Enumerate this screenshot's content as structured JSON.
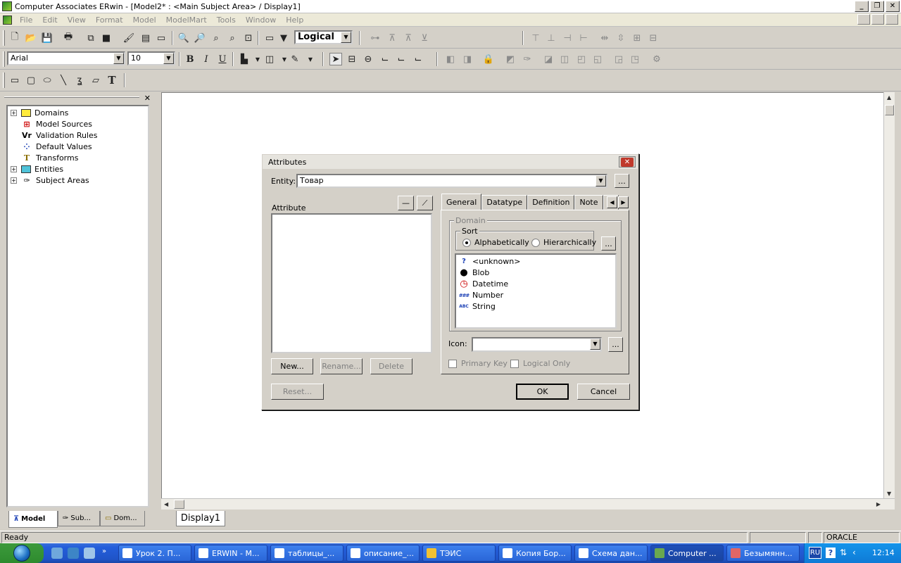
{
  "window": {
    "title": "Computer Associates ERwin - [Model2* : <Main Subject Area> / Display1]"
  },
  "menu": [
    "File",
    "Edit",
    "View",
    "Format",
    "Model",
    "ModelMart",
    "Tools",
    "Window",
    "Help"
  ],
  "toolbar": {
    "view_mode": "Logical",
    "font_name": "Arial",
    "font_size": "10",
    "bold": "B",
    "italic": "I",
    "underline": "U",
    "text_tool": "T"
  },
  "tree": {
    "items": [
      {
        "label": "Domains",
        "expandable": true,
        "icon": "domains-icon"
      },
      {
        "label": "Model Sources",
        "expandable": false,
        "icon": "model-sources-icon"
      },
      {
        "label": "Validation Rules",
        "expandable": false,
        "icon": "validation-rules-icon"
      },
      {
        "label": "Default Values",
        "expandable": false,
        "icon": "default-values-icon"
      },
      {
        "label": "Transforms",
        "expandable": false,
        "icon": "transforms-icon"
      },
      {
        "label": "Entities",
        "expandable": true,
        "icon": "entities-icon"
      },
      {
        "label": "Subject Areas",
        "expandable": true,
        "icon": "subject-areas-icon"
      }
    ],
    "plus_sign": "+"
  },
  "left_tabs": [
    "Model",
    "Sub...",
    "Dom..."
  ],
  "display_tab": "Display1",
  "status": {
    "left": "Ready",
    "db": "ORACLE"
  },
  "dialog": {
    "title": "Attributes",
    "entity_label": "Entity:",
    "entity_value": "Товар",
    "ellipsis": "...",
    "attribute_label": "Attribute",
    "tabs": [
      "General",
      "Datatype",
      "Definition",
      "Note"
    ],
    "domain_group": "Domain",
    "sort_group": "Sort",
    "sort_alpha": "Alphabetically",
    "sort_hier": "Hierarchically",
    "domains": [
      {
        "label": "<unknown>",
        "icon": "unknown-icon",
        "glyph": "?"
      },
      {
        "label": "Blob",
        "icon": "blob-icon",
        "glyph": "●"
      },
      {
        "label": "Datetime",
        "icon": "clock-icon",
        "glyph": "◷"
      },
      {
        "label": "Number",
        "icon": "number-icon",
        "glyph": "###"
      },
      {
        "label": "String",
        "icon": "string-icon",
        "glyph": "ABC"
      }
    ],
    "icon_label": "Icon:",
    "primary_key": "Primary Key",
    "logical_only": "Logical Only",
    "buttons": {
      "new": "New...",
      "rename": "Rename...",
      "delete": "Delete",
      "reset": "Reset...",
      "ok": "OK",
      "cancel": "Cancel"
    }
  },
  "taskbar": {
    "tasks": [
      "Урок 2. П...",
      "ERWIN - M...",
      "таблицы_...",
      "описание_...",
      "ТЭИС",
      "Копия Бор...",
      "Схема дан...",
      "Computer ...",
      "Безымянн..."
    ],
    "lang": "RU",
    "clock": "12:14"
  }
}
